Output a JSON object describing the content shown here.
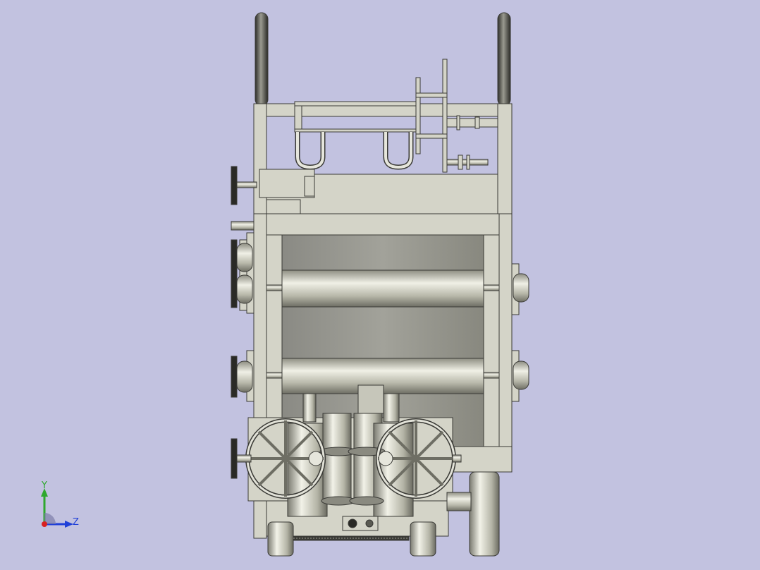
{
  "viewport": {
    "background": "#c2c2e0",
    "part_color": "#d4d4c8",
    "outline_color": "#3a3a36"
  },
  "triad": {
    "y_label": "Y",
    "z_label": "Z",
    "y_color": "#2ea82e",
    "z_color": "#2040d8",
    "x_color": "#d82020"
  }
}
